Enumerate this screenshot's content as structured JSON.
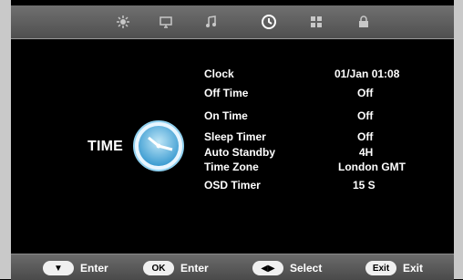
{
  "menu": {
    "tabs": [
      {
        "icon": "picture-icon",
        "active": false
      },
      {
        "icon": "monitor-icon",
        "active": false
      },
      {
        "icon": "music-note-icon",
        "active": false
      },
      {
        "icon": "time-icon",
        "active": true
      },
      {
        "icon": "grid-icon",
        "active": false
      },
      {
        "icon": "lock-icon",
        "active": false
      }
    ],
    "accent_color": "#ffffff",
    "bar_color": "#5f5f5f"
  },
  "page": {
    "title": "TIME",
    "icon": "clock-icon"
  },
  "settings": [
    {
      "label": "Clock",
      "value": "01/Jan  01:08"
    },
    {
      "label": "Off Time",
      "value": "Off"
    },
    {
      "label": "On Time",
      "value": "Off"
    },
    {
      "label": "Sleep Timer",
      "value": "Off"
    },
    {
      "label": "Auto Standby",
      "value": "4H"
    },
    {
      "label": "Time Zone",
      "value": "London GMT"
    },
    {
      "label": "OSD Timer",
      "value": "15 S"
    }
  ],
  "footer": [
    {
      "key": "▼",
      "label": "Enter"
    },
    {
      "key": "OK",
      "label": "Enter"
    },
    {
      "key": "◀▶",
      "label": "Select"
    },
    {
      "key": "Exit",
      "label": "Exit"
    }
  ]
}
